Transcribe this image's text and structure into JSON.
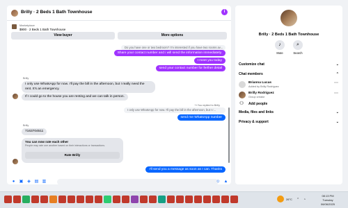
{
  "chat": {
    "title": "Brilly · 2 Beds 1 Bath Townhouse",
    "marketplace_label": "Marketplace",
    "listing": "$900 · 2 Beds 1 Bath Townhouse",
    "view_buyer": "View buyer",
    "more_options": "More options",
    "messages": {
      "q1": "Do you have one or two bedroom? I'm interested if you have two rooms av...",
      "m1": "Share your contact number and i will send the information immediately.",
      "m2": "I meet you today",
      "m3": "send your contact number for ferther detail",
      "sender1": "Brilly",
      "in1": "I only use WhatsApp for now. I'll pay the bill in the afternoon, but I really need the rent. It's an emergency.",
      "in2": "If I could go to the house you are renting and we can talk in person.",
      "replied_label": "You replied to Brilly",
      "q2": "I only use WhatsApp for now. I'll pay the bill in the afternoon, but I r...",
      "m4": "send me WhatsApp number",
      "sender2": "Brilly",
      "phone": "7163704511",
      "rate_title": "You can now rate each other",
      "rate_sub": "People may rate one another based on their interactions or transactions.",
      "rate_button": "Rate Brilly",
      "m5": "I'll send you a message as soon as I can. Thanks"
    }
  },
  "side": {
    "title": "Brilly · 2 Beds 1 Bath Townhouse",
    "mute": "Mute",
    "search": "Search",
    "customize": "Customize chat",
    "members_header": "Chat members",
    "member1_name": "Brianna Lucas",
    "member1_role": "Added by Brilly Rodriguez",
    "member2_name": "Brilly Rodriguez",
    "member2_role": "Group creator",
    "add_people": "Add people",
    "media": "Media, files and links",
    "privacy": "Privacy & support"
  },
  "taskbar": {
    "temp": "26°C",
    "time": "08:13 PM",
    "day": "Tuesday",
    "date": "06/06/2025"
  },
  "colors": {
    "accent_purple": "#a033ff",
    "accent_blue": "#0866ff"
  }
}
